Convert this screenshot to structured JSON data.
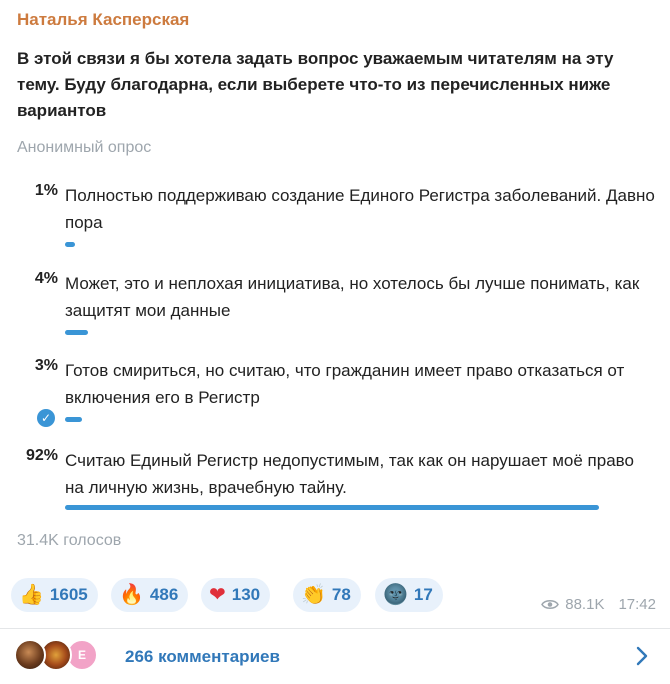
{
  "post": {
    "author": "Наталья Касперская",
    "question": "В этой связи я бы хотела задать вопрос уважаемым читателям на эту тему. Буду благодарна, если выберете что-то из перечисленных ниже вариантов"
  },
  "poll": {
    "type_label": "Анонимный опрос",
    "options": [
      {
        "percent_label": "1%",
        "percent": 1,
        "text": "Полностью поддерживаю создание Единого Регистра заболеваний. Давно пора",
        "selected": false
      },
      {
        "percent_label": "4%",
        "percent": 4,
        "text": "Может, это и неплохая инициатива, но хотелось бы лучше понимать, как защитят мои данные",
        "selected": false
      },
      {
        "percent_label": "3%",
        "percent": 3,
        "text": "Готов смириться, но считаю, что гражданин имеет право отказаться от включения его в Регистр",
        "selected": true
      },
      {
        "percent_label": "92%",
        "percent": 92,
        "text": "Считаю Единый Регистр недопустимым, так как он нарушает моё право на личную жизнь, врачебную тайну.",
        "selected": false
      }
    ],
    "votes_label": "31.4K голосов",
    "bar_color": "#3a95d6"
  },
  "reactions": [
    {
      "icon": "thumbs-up-icon",
      "glyph": "👍",
      "count": "1605"
    },
    {
      "icon": "fire-icon",
      "glyph": "🔥",
      "count": "486"
    },
    {
      "icon": "heart-icon",
      "glyph": "❤",
      "count": "130"
    },
    {
      "icon": "clapping-hands-icon",
      "glyph": "👏",
      "count": "78"
    },
    {
      "icon": "dark-face-icon",
      "glyph": "🌚",
      "count": "17"
    }
  ],
  "meta": {
    "views": "88.1K",
    "time": "17:42"
  },
  "comments": {
    "label": "266 комментариев",
    "avatar_letter": "E"
  },
  "colors": {
    "author": "#cd7b3f",
    "accent": "#3178b9",
    "muted": "#9ea6ad"
  }
}
